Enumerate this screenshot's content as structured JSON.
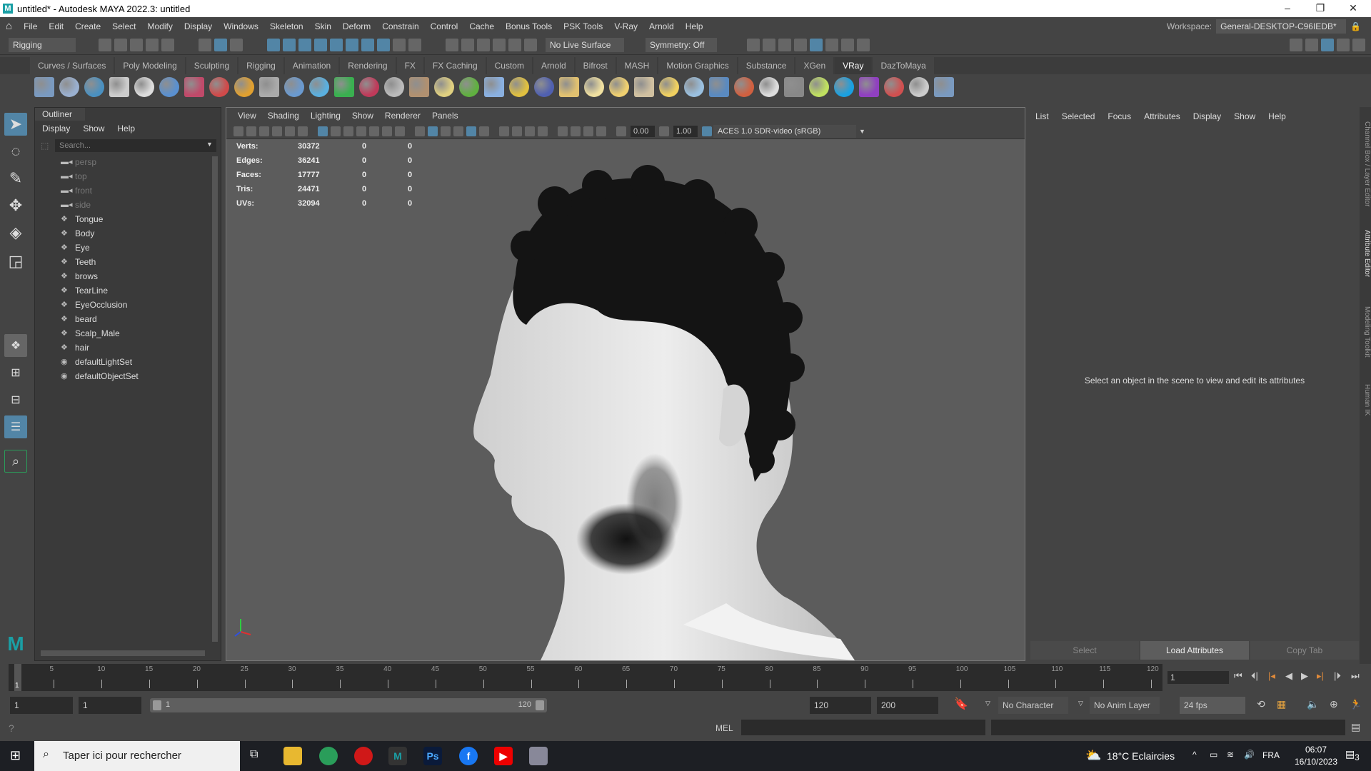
{
  "window": {
    "title": "untitled* - Autodesk MAYA 2022.3: untitled",
    "logo": "M",
    "minimize": "–",
    "restore": "❐",
    "close": "✕"
  },
  "menubar": [
    "File",
    "Edit",
    "Create",
    "Select",
    "Modify",
    "Display",
    "Windows",
    "Skeleton",
    "Skin",
    "Deform",
    "Constrain",
    "Control",
    "Cache",
    "Bonus Tools",
    "PSK Tools",
    "V-Ray",
    "Arnold",
    "Help"
  ],
  "workspace": {
    "label": "Workspace:",
    "value": "General-DESKTOP-C96IEDB*"
  },
  "statusbar": {
    "mode": "Rigging",
    "live_surface": "No Live Surface",
    "symmetry": "Symmetry: Off"
  },
  "shelf_tabs": [
    "Curves / Surfaces",
    "Poly Modeling",
    "Sculpting",
    "Rigging",
    "Animation",
    "Rendering",
    "FX",
    "FX Caching",
    "Custom",
    "Arnold",
    "Bifrost",
    "MASH",
    "Motion Graphics",
    "Substance",
    "XGen",
    "VRay",
    "DazToMaya"
  ],
  "active_shelf": "VRay",
  "shelf_icons": [
    "vray-settings",
    "vray-render-elements",
    "vray-frame-buffer",
    "vray-plugin",
    "vray-log",
    "vray-sphere",
    "vray-camera",
    "vray-mtl",
    "vray-fire",
    "vray-proxy",
    "vray-plane",
    "vray-light-dome",
    "vray-light-sphere",
    "vray-light-mesh",
    "vray-light-ies",
    "vray-mtl-blend",
    "vray-grid",
    "vray-globe",
    "vray-fur",
    "vray-scatter",
    "vray-hair",
    "vray-sphere-fade",
    "vray-light-rect",
    "vray-sun-lamp",
    "vray-bulb",
    "vray-cone",
    "vray-sun",
    "vray-box",
    "vray-ball",
    "vray-mirror",
    "vray-checker",
    "vray-vfb",
    "vray-bulb-info",
    "vray-cloud",
    "vray-cosmos",
    "vray-palette",
    "help"
  ],
  "outliner": {
    "title": "Outliner",
    "menu": [
      "Display",
      "Show",
      "Help"
    ],
    "search_placeholder": "Search...",
    "items": [
      {
        "label": "persp",
        "type": "camera"
      },
      {
        "label": "top",
        "type": "camera"
      },
      {
        "label": "front",
        "type": "camera"
      },
      {
        "label": "side",
        "type": "camera"
      },
      {
        "label": "Tongue",
        "type": "mesh"
      },
      {
        "label": "Body",
        "type": "mesh"
      },
      {
        "label": "Eye",
        "type": "mesh"
      },
      {
        "label": "Teeth",
        "type": "mesh"
      },
      {
        "label": "brows",
        "type": "mesh"
      },
      {
        "label": "TearLine",
        "type": "mesh"
      },
      {
        "label": "EyeOcclusion",
        "type": "mesh"
      },
      {
        "label": "beard",
        "type": "mesh"
      },
      {
        "label": "Scalp_Male",
        "type": "mesh"
      },
      {
        "label": "hair",
        "type": "mesh"
      },
      {
        "label": "defaultLightSet",
        "type": "set"
      },
      {
        "label": "defaultObjectSet",
        "type": "set"
      }
    ]
  },
  "viewport": {
    "menu": [
      "View",
      "Shading",
      "Lighting",
      "Show",
      "Renderer",
      "Panels"
    ],
    "exposure": "0.00",
    "gamma": "1.00",
    "color_space": "ACES 1.0 SDR-video (sRGB)",
    "stats": [
      {
        "label": "Verts:",
        "values": [
          "30372",
          "0",
          "0"
        ]
      },
      {
        "label": "Edges:",
        "values": [
          "36241",
          "0",
          "0"
        ]
      },
      {
        "label": "Faces:",
        "values": [
          "17777",
          "0",
          "0"
        ]
      },
      {
        "label": "Tris:",
        "values": [
          "24471",
          "0",
          "0"
        ]
      },
      {
        "label": "UVs:",
        "values": [
          "32094",
          "0",
          "0"
        ]
      }
    ]
  },
  "attribute_editor": {
    "menu": [
      "List",
      "Selected",
      "Focus",
      "Attributes",
      "Display",
      "Show",
      "Help"
    ],
    "message": "Select an object in the scene to view and edit its attributes",
    "buttons": [
      "Select",
      "Load Attributes",
      "Copy Tab"
    ]
  },
  "side_tabs": [
    "Channel Box / Layer Editor",
    "Attribute Editor",
    "Modeling Toolkit",
    "Human IK"
  ],
  "timeline": {
    "start": 1,
    "end": 120,
    "major_step": 5,
    "current_frame": "1",
    "current_label": "1"
  },
  "range": {
    "start": "1",
    "playback_start": "1",
    "slider_start": "1",
    "slider_end": "120",
    "playback_end": "120",
    "end": "200",
    "character_set": "No Character Set",
    "anim_layer": "No Anim Layer",
    "fps": "24 fps"
  },
  "command": {
    "language": "MEL"
  },
  "taskbar": {
    "search_placeholder": "Taper ici pour rechercher",
    "weather": "18°C  Eclaircies",
    "language": "FRA",
    "time": "06:07",
    "date": "16/10/2023",
    "notifications": "3"
  }
}
